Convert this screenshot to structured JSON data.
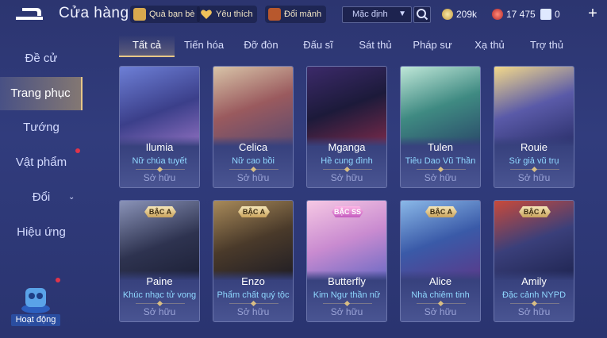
{
  "header": {
    "title": "Cửa hàng",
    "chips": [
      {
        "label": "Quà bạn bè",
        "icon": "gift-icon"
      },
      {
        "label": "Yêu thích",
        "icon": "heart-icon"
      },
      {
        "label": "Đổi mảnh",
        "icon": "fragment-icon"
      }
    ],
    "sort_value": "Mặc định",
    "currencies": [
      {
        "value": "209k",
        "icon": "gold-coin-icon"
      },
      {
        "value": "17 475",
        "icon": "voucher-icon"
      },
      {
        "value": "0",
        "icon": "diamond-icon"
      }
    ],
    "plus_label": "+"
  },
  "sidebar": {
    "items": [
      {
        "label": "Đề cử"
      },
      {
        "label": "Trang phục"
      },
      {
        "label": "Tướng"
      },
      {
        "label": "Vật phẩm"
      },
      {
        "label": "Đổi"
      },
      {
        "label": "Hiệu ứng"
      }
    ],
    "activity_label": "Hoạt động"
  },
  "tabs": [
    "Tất cả",
    "Tiến hóa",
    "Đỡ đòn",
    "Đấu sĩ",
    "Sát thủ",
    "Pháp sư",
    "Xạ thủ",
    "Trợ thủ"
  ],
  "cards": [
    {
      "name": "Ilumia",
      "skin": "Nữ chúa tuyết",
      "status": "Sở hữu",
      "tier": ""
    },
    {
      "name": "Celica",
      "skin": "Nữ cao bồi",
      "status": "Sở hữu",
      "tier": ""
    },
    {
      "name": "Mganga",
      "skin": "Hề cung đình",
      "status": "Sở hữu",
      "tier": ""
    },
    {
      "name": "Tulen",
      "skin": "Tiêu Dao Vũ Thần",
      "status": "Sở hữu",
      "tier": ""
    },
    {
      "name": "Rouie",
      "skin": "Sứ giả vũ trụ",
      "status": "Sở hữu",
      "tier": ""
    },
    {
      "name": "Paine",
      "skin": "Khúc nhạc tử vong",
      "status": "Sở hữu",
      "tier": "BẬC A"
    },
    {
      "name": "Enzo",
      "skin": "Phẩm chất quý tộc",
      "status": "Sở hữu",
      "tier": "BẬC A"
    },
    {
      "name": "Butterfly",
      "skin": "Kim Ngư thần nữ",
      "status": "Sở hữu",
      "tier": "BẬC SS"
    },
    {
      "name": "Alice",
      "skin": "Nhà chiêm tinh",
      "status": "Sở hữu",
      "tier": "BẬC A"
    },
    {
      "name": "Amily",
      "skin": "Đặc cảnh NYPD",
      "status": "Sở hữu",
      "tier": "BẬC A"
    }
  ],
  "colors": {
    "accent_gold": "#e7c787",
    "skin_name": "#8fd7ff",
    "notification_dot": "#e0344a"
  }
}
